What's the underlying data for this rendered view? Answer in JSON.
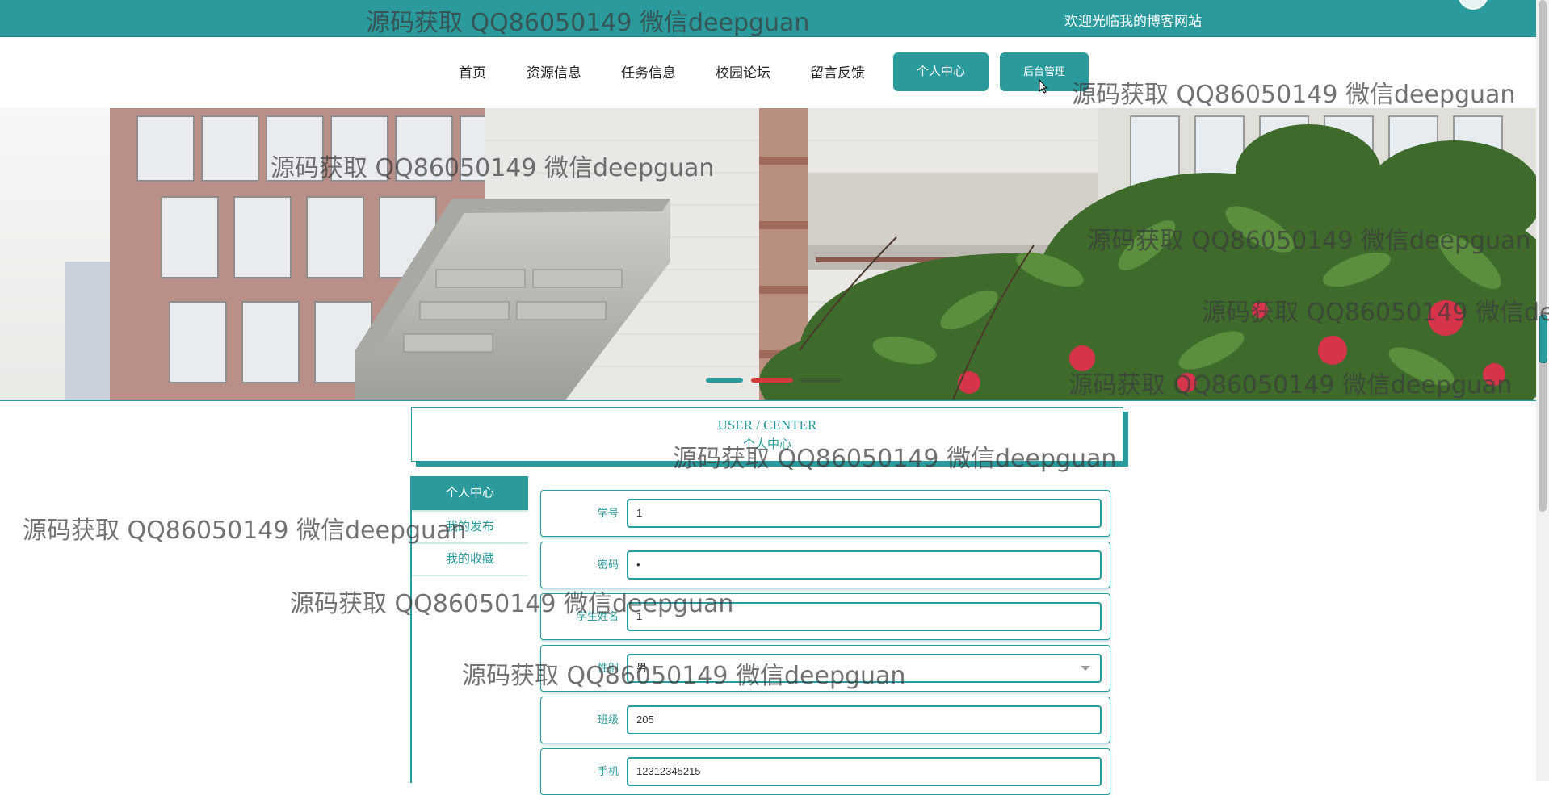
{
  "header": {
    "welcome": "欢迎光临我的博客网站"
  },
  "nav": {
    "items": [
      "首页",
      "资源信息",
      "任务信息",
      "校园论坛",
      "留言反馈"
    ],
    "personal_center": "个人中心",
    "admin": "后台管理"
  },
  "banner": {
    "slides": 3,
    "active_slide": 1
  },
  "title_box": {
    "en": "USER / CENTER",
    "cn": "个人中心"
  },
  "sidebar": {
    "items": [
      "个人中心",
      "我的发布",
      "我的收藏"
    ],
    "active_index": 0
  },
  "form": {
    "fields": [
      {
        "label": "学号",
        "value": "1"
      },
      {
        "label": "密码",
        "value": "•"
      },
      {
        "label": "学生姓名",
        "value": "1"
      },
      {
        "label": "性别",
        "value": "男"
      },
      {
        "label": "班级",
        "value": "205"
      },
      {
        "label": "手机",
        "value": "12312345215"
      }
    ]
  },
  "watermark": "源码获取 QQ86050149 微信deepguan",
  "colors": {
    "primary": "#2a9a9c",
    "primary_dark": "#1f7f81"
  }
}
